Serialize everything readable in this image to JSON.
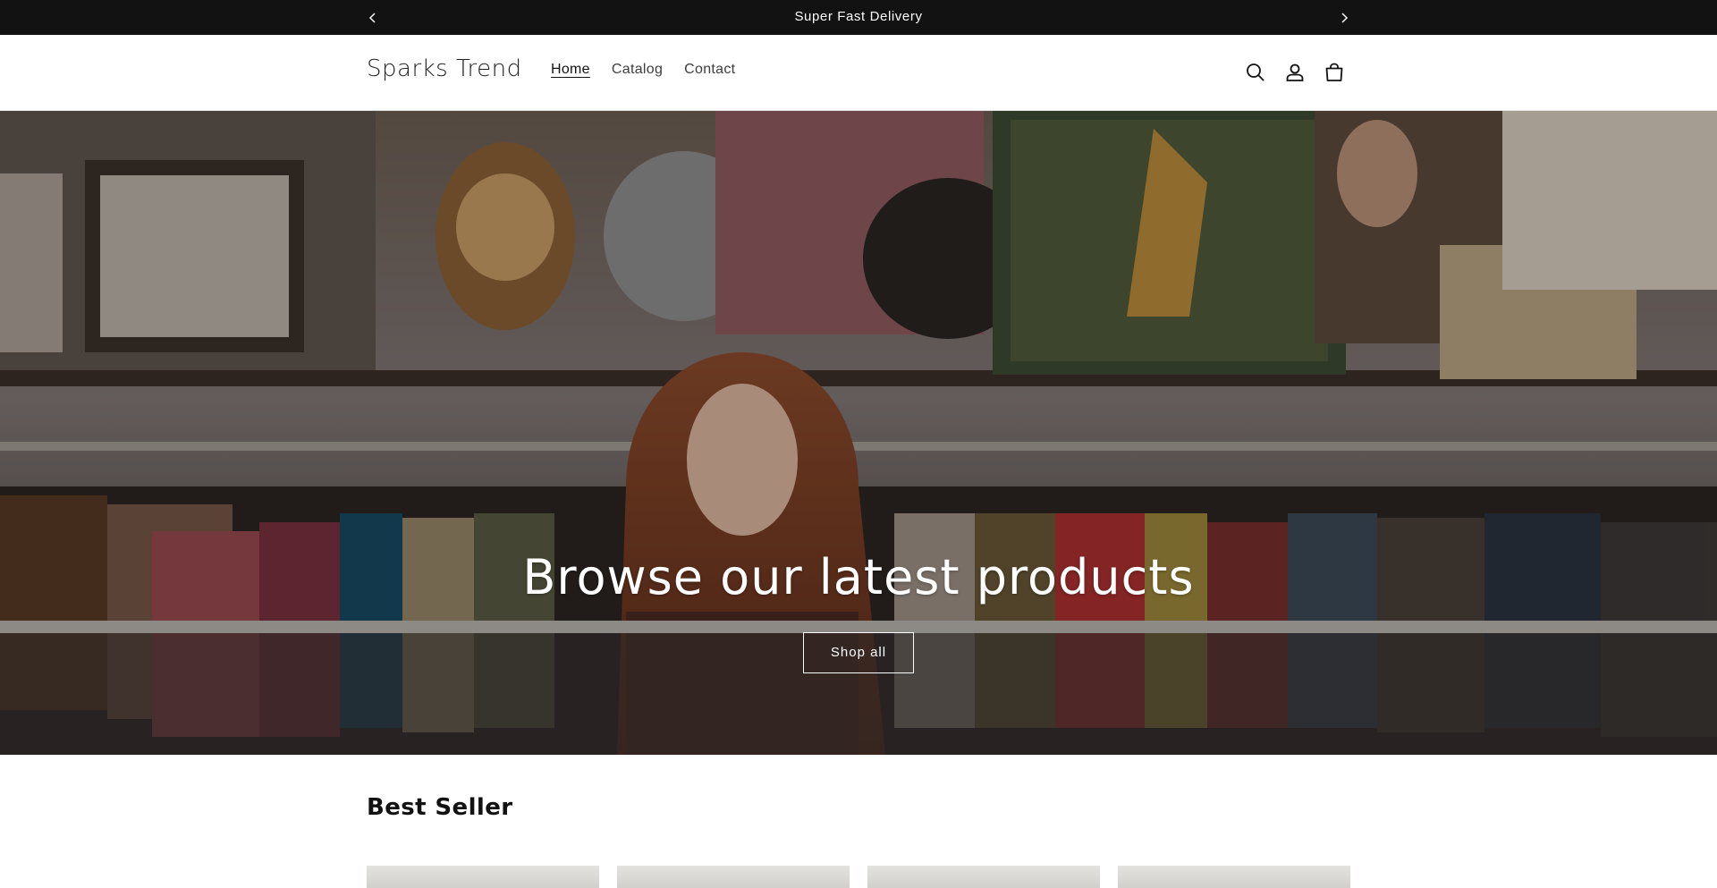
{
  "announcement": {
    "message": "Super Fast Delivery",
    "prev_icon": "chevron-left-icon",
    "next_icon": "chevron-right-icon"
  },
  "header": {
    "logo": "Sparks Trend",
    "nav": [
      {
        "label": "Home",
        "active": true
      },
      {
        "label": "Catalog",
        "active": false
      },
      {
        "label": "Contact",
        "active": false
      }
    ],
    "icons": [
      "search-icon",
      "account-icon",
      "cart-icon"
    ]
  },
  "hero": {
    "title": "Browse our latest products",
    "button_label": "Shop all"
  },
  "best_seller": {
    "title": "Best Seller"
  },
  "colors": {
    "announcement_bg": "#121212",
    "text": "#121212",
    "background": "#ffffff"
  }
}
